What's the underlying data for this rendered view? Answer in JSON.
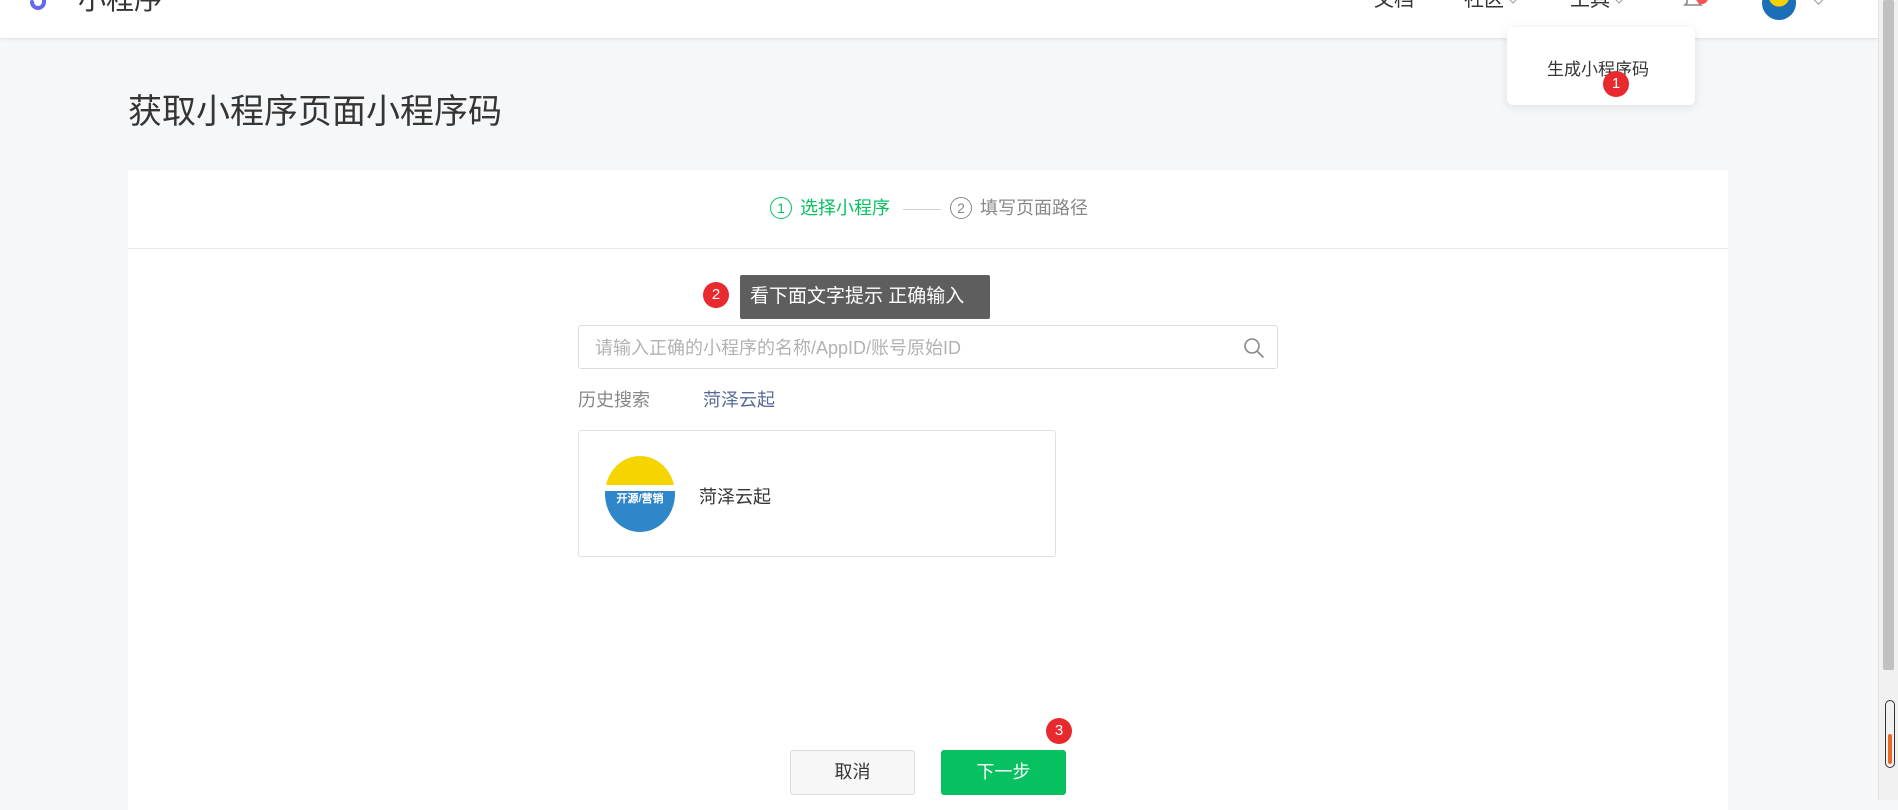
{
  "header": {
    "brand": "小程序",
    "nav": {
      "docs": "文档",
      "community": "社区",
      "tools": "工具"
    }
  },
  "dropdown": {
    "item": "生成小程序码"
  },
  "badges": {
    "one": "1",
    "two": "2",
    "three": "3"
  },
  "page": {
    "title": "获取小程序页面小程序码"
  },
  "steps": [
    {
      "num": "1",
      "label": "选择小程序",
      "active": true
    },
    {
      "num": "2",
      "label": "填写页面路径",
      "active": false
    }
  ],
  "tooltip": "看下面文字提示 正确输入",
  "search": {
    "placeholder": "请输入正确的小程序的名称/AppID/账号原始ID",
    "value": ""
  },
  "history": {
    "label": "历史搜索",
    "items": [
      "菏泽云起"
    ]
  },
  "result": {
    "name": "菏泽云起",
    "logo_text": "开源/营销"
  },
  "buttons": {
    "cancel": "取消",
    "next": "下一步"
  },
  "colors": {
    "accent": "#07c160",
    "badge": "#e8292e",
    "link": "#576b95"
  }
}
